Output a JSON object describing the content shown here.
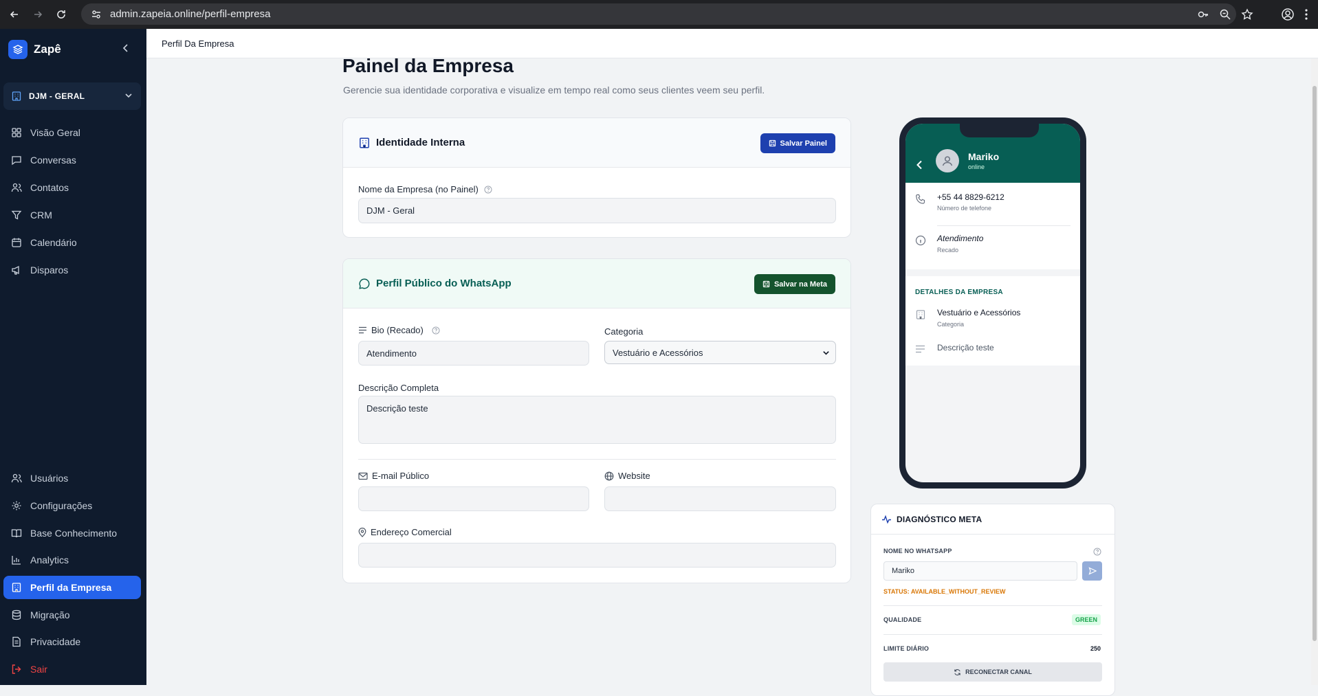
{
  "browser": {
    "url": "admin.zapeia.online/perfil-empresa"
  },
  "sidebar": {
    "brand": "Zapê",
    "workspace": "DJM - GERAL",
    "top_items": [
      {
        "label": "Visão Geral",
        "icon": "grid-icon"
      },
      {
        "label": "Conversas",
        "icon": "chat-icon"
      },
      {
        "label": "Contatos",
        "icon": "users-icon"
      },
      {
        "label": "CRM",
        "icon": "filter-icon"
      },
      {
        "label": "Calendário",
        "icon": "calendar-icon"
      },
      {
        "label": "Disparos",
        "icon": "megaphone-icon"
      }
    ],
    "bottom_items": [
      {
        "label": "Usuários",
        "icon": "users-icon"
      },
      {
        "label": "Configurações",
        "icon": "gear-icon"
      },
      {
        "label": "Base Conhecimento",
        "icon": "book-icon"
      },
      {
        "label": "Analytics",
        "icon": "bar-chart-icon"
      },
      {
        "label": "Perfil da Empresa",
        "icon": "building-icon",
        "active": true
      },
      {
        "label": "Migração",
        "icon": "database-icon"
      },
      {
        "label": "Privacidade",
        "icon": "document-icon"
      },
      {
        "label": "Sair",
        "icon": "logout-icon"
      }
    ]
  },
  "topbar": {
    "breadcrumb": "Perfil Da Empresa"
  },
  "page": {
    "title": "Painel da Empresa",
    "subtitle": "Gerencie sua identidade corporativa e visualize em tempo real como seus clientes veem seu perfil."
  },
  "identity_card": {
    "title": "Identidade Interna",
    "save_label": "Salvar Painel",
    "company_label": "Nome da Empresa (no Painel)",
    "company_value": "DJM - Geral"
  },
  "whatsapp_card": {
    "title": "Perfil Público do WhatsApp",
    "save_label": "Salvar na Meta",
    "bio_label": "Bio (Recado)",
    "bio_value": "Atendimento",
    "category_label": "Categoria",
    "category_value": "Vestuário e Acessórios",
    "description_label": "Descrição Completa",
    "description_value": "Descrição teste",
    "email_label": "E-mail Público",
    "email_value": "",
    "website_label": "Website",
    "website_value": "",
    "address_label": "Endereço Comercial",
    "address_value": ""
  },
  "phone_preview": {
    "contact_name": "Mariko",
    "contact_status": "online",
    "phone_number": "+55 44 8829-6212",
    "phone_caption": "Número de telefone",
    "bio": "Atendimento",
    "bio_caption": "Recado",
    "section_title": "DETALHES DA EMPRESA",
    "category": "Vestuário e Acessórios",
    "category_caption": "Categoria",
    "description": "Descrição teste"
  },
  "diagnostics": {
    "title": "DIAGNÓSTICO META",
    "name_label": "NOME NO WHATSAPP",
    "name_value": "Mariko",
    "status_text": "STATUS: AVAILABLE_WITHOUT_REVIEW",
    "quality_label": "QUALIDADE",
    "quality_value": "GREEN",
    "limit_label": "LIMITE DIÁRIO",
    "limit_value": "250",
    "reconnect_label": "RECONECTAR CANAL"
  },
  "colors": {
    "sidebar_bg": "#0f1b2d",
    "accent_blue": "#2563eb",
    "identity_button": "#1e40af",
    "whatsapp_green": "#075e54",
    "meta_button": "#14532d",
    "status_orange": "#d97706",
    "quality_green": "#16a34a"
  }
}
